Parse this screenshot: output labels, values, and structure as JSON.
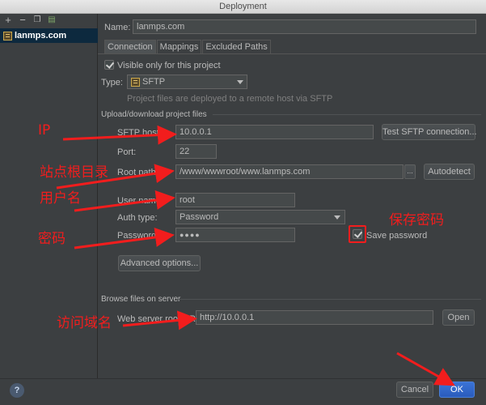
{
  "window": {
    "title": "Deployment"
  },
  "left_panel": {
    "items": [
      {
        "label": "lanmps.com"
      }
    ]
  },
  "name": {
    "label": "Name:",
    "value": "lanmps.com"
  },
  "tabs": [
    {
      "label": "Connection"
    },
    {
      "label": "Mappings"
    },
    {
      "label": "Excluded Paths"
    }
  ],
  "visible_only": {
    "label": "Visible only for this project",
    "checked": true
  },
  "type": {
    "label": "Type:",
    "value": "SFTP",
    "hint": "Project files are deployed to a remote host via SFTP"
  },
  "upload_section": {
    "title": "Upload/download project files"
  },
  "sftp_host": {
    "label": "SFTP host:",
    "value": "10.0.0.1",
    "test_button": "Test SFTP connection..."
  },
  "port": {
    "label": "Port:",
    "value": "22"
  },
  "root_path": {
    "label": "Root path:",
    "value": "/www/wwwroot/www.lanmps.com",
    "browse": "...",
    "autodetect": "Autodetect"
  },
  "user_name": {
    "label": "User name:",
    "value": "root"
  },
  "auth_type": {
    "label": "Auth type:",
    "value": "Password"
  },
  "password": {
    "label": "Password:",
    "value": "●●●●",
    "save_label": "Save password",
    "save_checked": true
  },
  "advanced": {
    "label": "Advanced options..."
  },
  "browse_section": {
    "title": "Browse files on server"
  },
  "web_root": {
    "label": "Web server root URL:",
    "value": "http://10.0.0.1",
    "open": "Open"
  },
  "footer": {
    "help": "?",
    "cancel": "Cancel",
    "ok": "OK"
  },
  "annotations": {
    "ip": "IP",
    "site_root": "站点根目录",
    "username": "用户名",
    "password": "密码",
    "save_password": "保存密码",
    "domain": "访问域名"
  },
  "colors": {
    "annotation": "#f21d1d",
    "ok_button": "#2f65ca",
    "selection": "#0d293e"
  }
}
